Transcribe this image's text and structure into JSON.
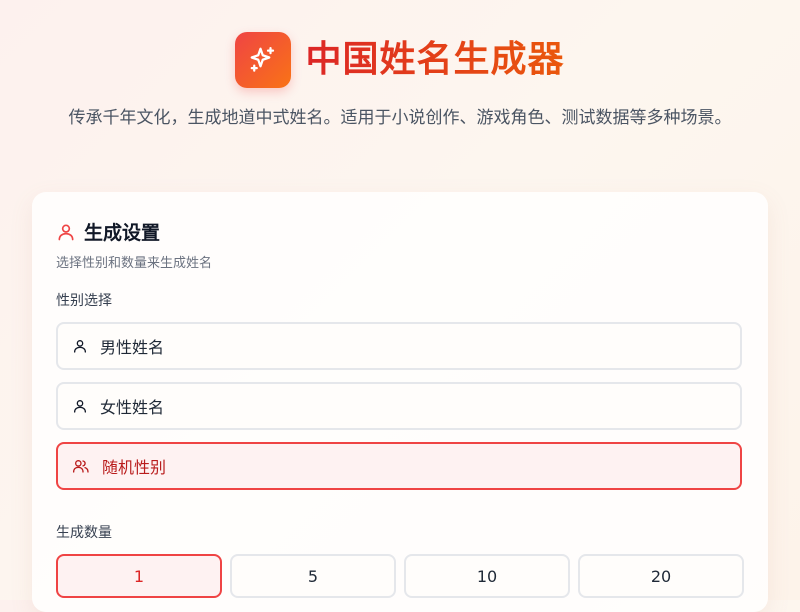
{
  "app": {
    "title": "中国姓名生成器",
    "subtitle": "传承千年文化，生成地道中式姓名。适用于小说创作、游戏角色、测试数据等多种场景。",
    "logo_icon": "sparkles-icon"
  },
  "settings": {
    "title": "生成设置",
    "description": "选择性别和数量来生成姓名",
    "gender_label": "性别选择",
    "gender_options": [
      {
        "label": "男性姓名",
        "icon": "user-icon",
        "selected": false
      },
      {
        "label": "女性姓名",
        "icon": "user-icon",
        "selected": false
      },
      {
        "label": "随机性别",
        "icon": "users-icon",
        "selected": true
      }
    ],
    "quantity_label": "生成数量",
    "quantity_options": [
      {
        "label": "1",
        "selected": true
      },
      {
        "label": "5",
        "selected": false
      },
      {
        "label": "10",
        "selected": false
      },
      {
        "label": "20",
        "selected": false
      }
    ]
  },
  "colors": {
    "accent": "#ef4444",
    "accent_dark": "#dc2626",
    "brand_gradient_end": "#f97316"
  }
}
